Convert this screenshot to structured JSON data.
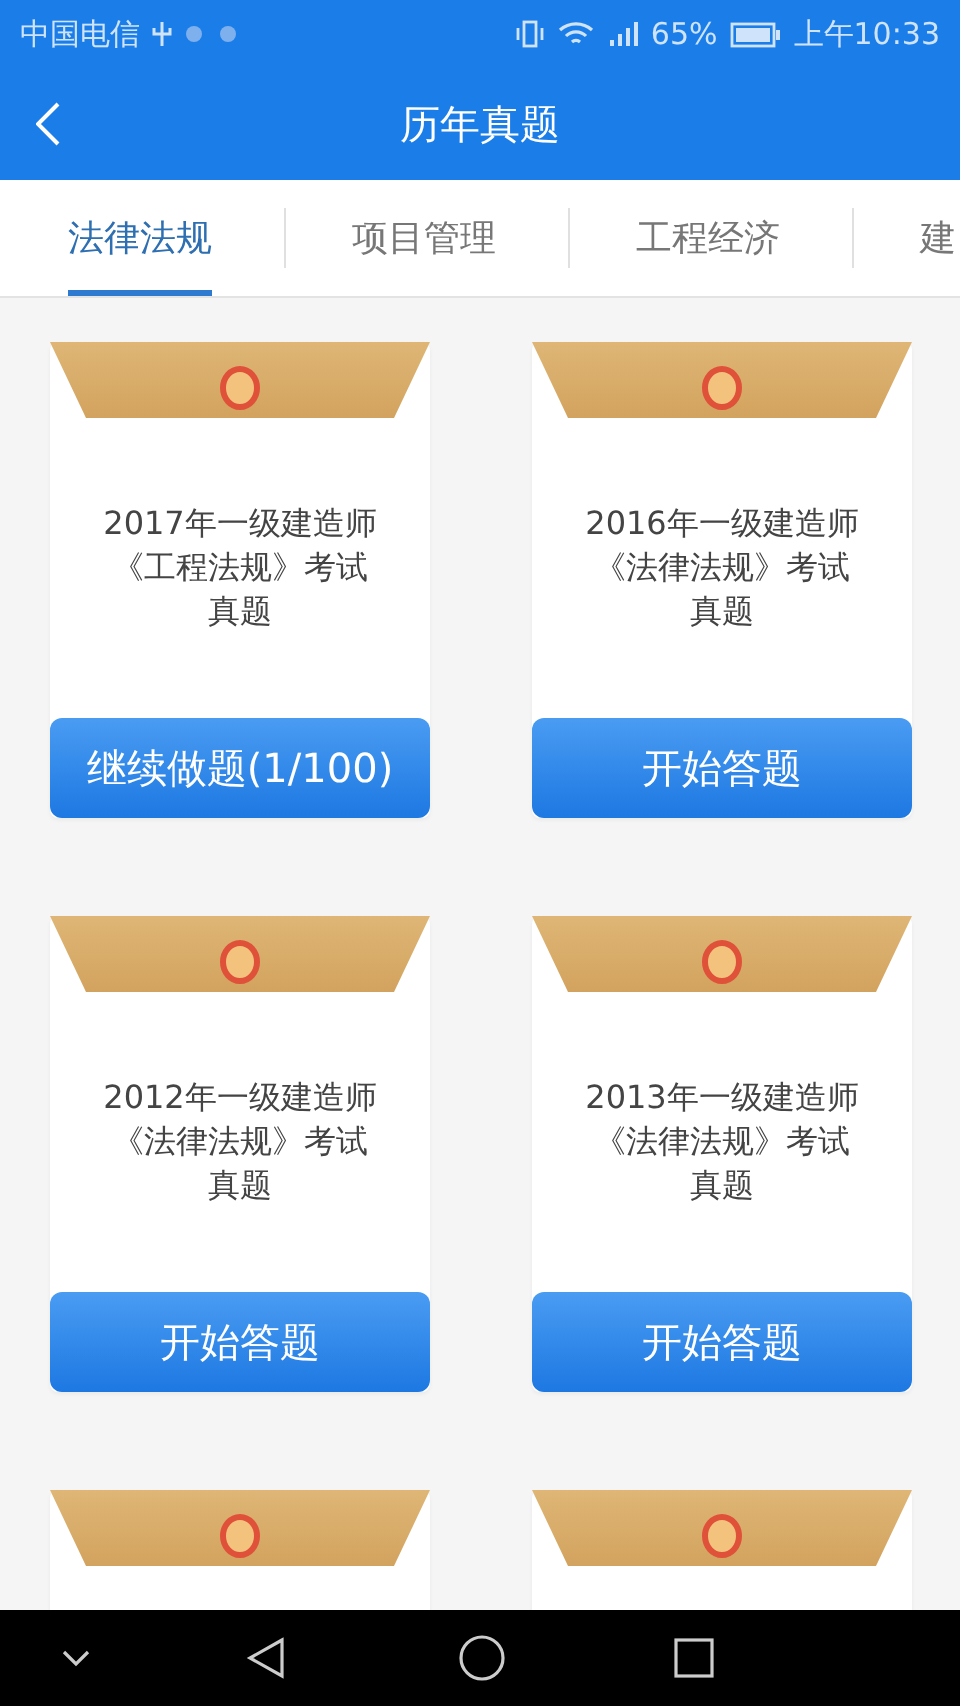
{
  "status_bar": {
    "carrier": "中国电信",
    "battery": "65%",
    "time": "上午10:33"
  },
  "app_bar": {
    "title": "历年真题"
  },
  "tabs": [
    {
      "label": "法律法规",
      "selected": true
    },
    {
      "label": "项目管理",
      "selected": false
    },
    {
      "label": "工程经济",
      "selected": false
    },
    {
      "label": "建",
      "selected": false
    }
  ],
  "papers": [
    {
      "kind": "full",
      "title": "2017年一级建造师《工程法规》考试真题",
      "button": "继续做题(1/100)"
    },
    {
      "kind": "full",
      "title": "2016年一级建造师《法律法规》考试真题",
      "button": "开始答题"
    },
    {
      "kind": "full",
      "title": "2012年一级建造师《法律法规》考试真题",
      "button": "开始答题"
    },
    {
      "kind": "full",
      "title": "2013年一级建造师《法律法规》考试真题",
      "button": "开始答题"
    },
    {
      "kind": "cut"
    },
    {
      "kind": "cut"
    }
  ]
}
